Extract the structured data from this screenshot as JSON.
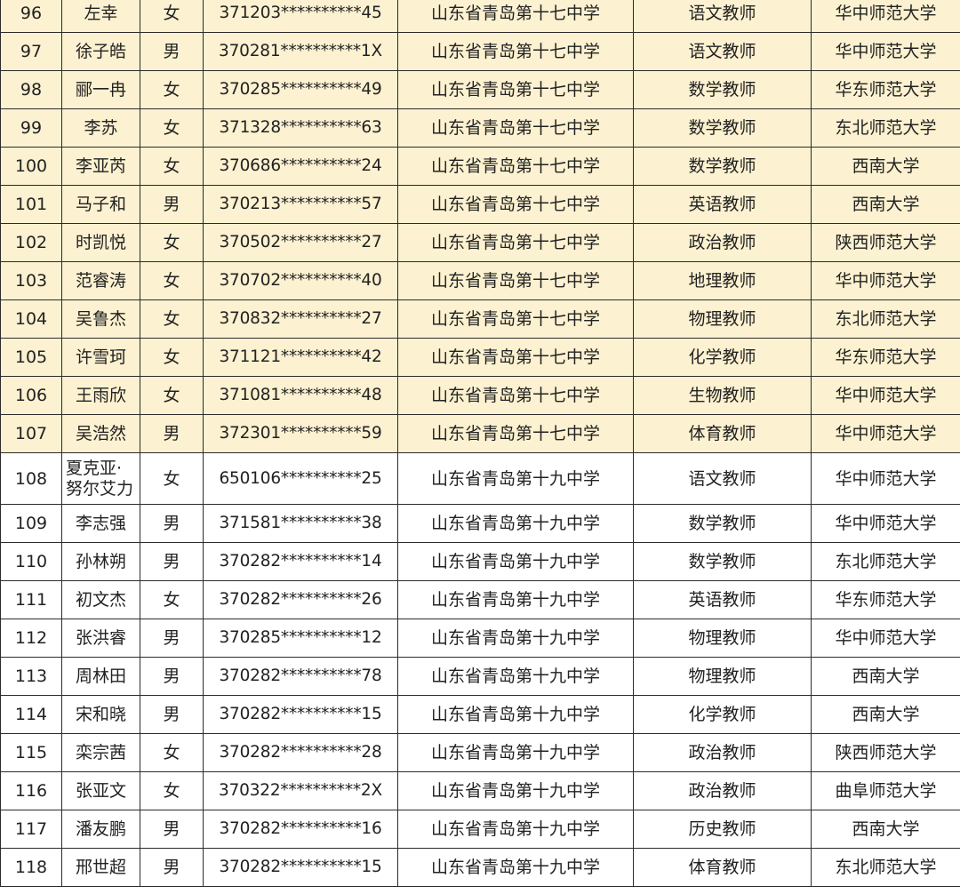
{
  "highlight_color": "#fcf1d0",
  "rows": [
    {
      "no": "96",
      "name": "左幸",
      "gender": "女",
      "id": "371203**********45",
      "school": "山东省青岛第十七中学",
      "post": "语文教师",
      "university": "华中师范大学"
    },
    {
      "no": "97",
      "name": "徐子皓",
      "gender": "男",
      "id": "370281**********1X",
      "school": "山东省青岛第十七中学",
      "post": "语文教师",
      "university": "华中师范大学"
    },
    {
      "no": "98",
      "name": "郦一冉",
      "gender": "女",
      "id": "370285**********49",
      "school": "山东省青岛第十七中学",
      "post": "数学教师",
      "university": "华东师范大学"
    },
    {
      "no": "99",
      "name": "李苏",
      "gender": "女",
      "id": "371328**********63",
      "school": "山东省青岛第十七中学",
      "post": "数学教师",
      "university": "东北师范大学"
    },
    {
      "no": "100",
      "name": "李亚芮",
      "gender": "女",
      "id": "370686**********24",
      "school": "山东省青岛第十七中学",
      "post": "数学教师",
      "university": "西南大学"
    },
    {
      "no": "101",
      "name": "马子和",
      "gender": "男",
      "id": "370213**********57",
      "school": "山东省青岛第十七中学",
      "post": "英语教师",
      "university": "西南大学"
    },
    {
      "no": "102",
      "name": "时凯悦",
      "gender": "女",
      "id": "370502**********27",
      "school": "山东省青岛第十七中学",
      "post": "政治教师",
      "university": "陕西师范大学"
    },
    {
      "no": "103",
      "name": "范睿涛",
      "gender": "女",
      "id": "370702**********40",
      "school": "山东省青岛第十七中学",
      "post": "地理教师",
      "university": "华中师范大学"
    },
    {
      "no": "104",
      "name": "吴鲁杰",
      "gender": "女",
      "id": "370832**********27",
      "school": "山东省青岛第十七中学",
      "post": "物理教师",
      "university": "东北师范大学"
    },
    {
      "no": "105",
      "name": "许雪珂",
      "gender": "女",
      "id": "371121**********42",
      "school": "山东省青岛第十七中学",
      "post": "化学教师",
      "university": "华东师范大学"
    },
    {
      "no": "106",
      "name": "王雨欣",
      "gender": "女",
      "id": "371081**********48",
      "school": "山东省青岛第十七中学",
      "post": "生物教师",
      "university": "华中师范大学"
    },
    {
      "no": "107",
      "name": "吴浩然",
      "gender": "男",
      "id": "372301**********59",
      "school": "山东省青岛第十七中学",
      "post": "体育教师",
      "university": "华中师范大学"
    },
    {
      "no": "108",
      "name": "夏克亚·努尔艾力",
      "gender": "女",
      "id": "650106**********25",
      "school": "山东省青岛第十九中学",
      "post": "语文教师",
      "university": "华中师范大学"
    },
    {
      "no": "109",
      "name": "李志强",
      "gender": "男",
      "id": "371581**********38",
      "school": "山东省青岛第十九中学",
      "post": "数学教师",
      "university": "华中师范大学"
    },
    {
      "no": "110",
      "name": "孙林朔",
      "gender": "男",
      "id": "370282**********14",
      "school": "山东省青岛第十九中学",
      "post": "数学教师",
      "university": "东北师范大学"
    },
    {
      "no": "111",
      "name": "初文杰",
      "gender": "女",
      "id": "370282**********26",
      "school": "山东省青岛第十九中学",
      "post": "英语教师",
      "university": "华东师范大学"
    },
    {
      "no": "112",
      "name": "张洪睿",
      "gender": "男",
      "id": "370285**********12",
      "school": "山东省青岛第十九中学",
      "post": "物理教师",
      "university": "华中师范大学"
    },
    {
      "no": "113",
      "name": "周林田",
      "gender": "男",
      "id": "370282**********78",
      "school": "山东省青岛第十九中学",
      "post": "物理教师",
      "university": "西南大学"
    },
    {
      "no": "114",
      "name": "宋和晓",
      "gender": "男",
      "id": "370282**********15",
      "school": "山东省青岛第十九中学",
      "post": "化学教师",
      "university": "西南大学"
    },
    {
      "no": "115",
      "name": "栾宗茜",
      "gender": "女",
      "id": "370282**********28",
      "school": "山东省青岛第十九中学",
      "post": "政治教师",
      "university": "陕西师范大学"
    },
    {
      "no": "116",
      "name": "张亚文",
      "gender": "女",
      "id": "370322**********2X",
      "school": "山东省青岛第十九中学",
      "post": "政治教师",
      "university": "曲阜师范大学"
    },
    {
      "no": "117",
      "name": "潘友鹏",
      "gender": "男",
      "id": "370282**********16",
      "school": "山东省青岛第十九中学",
      "post": "历史教师",
      "university": "西南大学"
    },
    {
      "no": "118",
      "name": "邢世超",
      "gender": "男",
      "id": "370282**********15",
      "school": "山东省青岛第十九中学",
      "post": "体育教师",
      "university": "东北师范大学"
    }
  ]
}
